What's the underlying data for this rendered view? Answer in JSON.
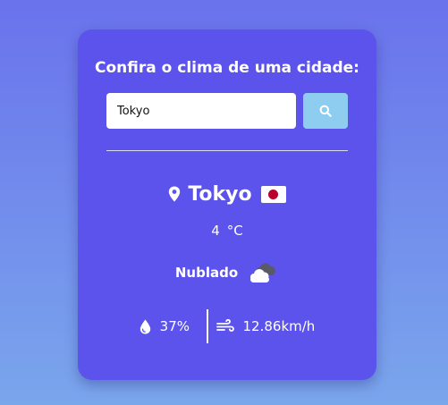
{
  "card": {
    "heading": "Confira o clima de uma cidade:"
  },
  "search": {
    "value": "Tokyo",
    "icon": "search-icon"
  },
  "weather": {
    "city": "Tokyo",
    "country_flag": "japan-flag-icon",
    "temperature": "4",
    "unit": "°C",
    "description": "Nublado",
    "description_icon": "cloud-icon",
    "humidity": "37%",
    "humidity_icon": "droplet-icon",
    "wind": "12.86km/h",
    "wind_icon": "wind-icon",
    "location_icon": "map-pin-icon"
  },
  "colors": {
    "card_bg": "#5b53ec",
    "button_bg": "#8fcdf0",
    "page_gradient_top": "#6a72ec",
    "page_gradient_bottom": "#7aa6ec"
  }
}
